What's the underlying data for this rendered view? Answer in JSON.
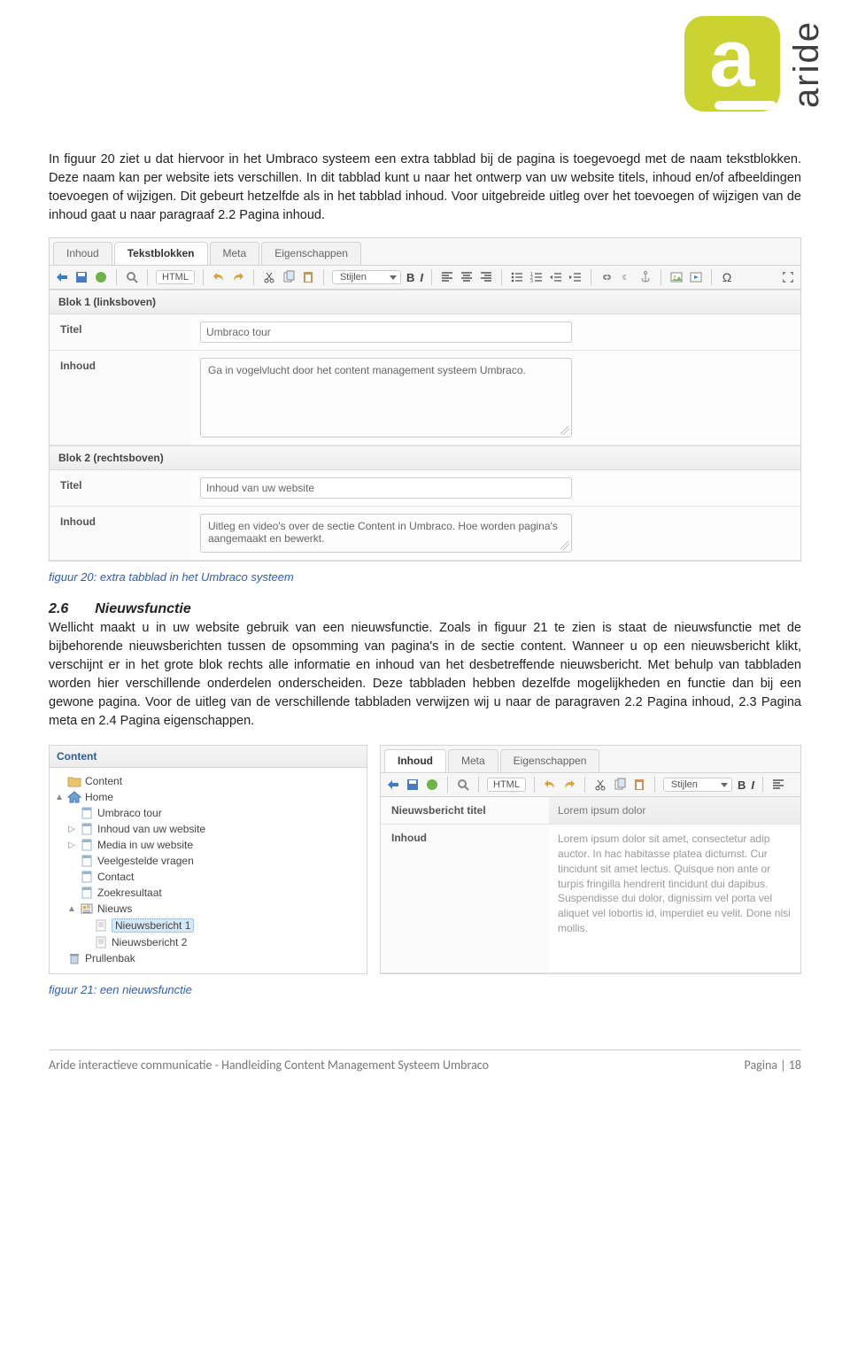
{
  "logo_text": "aride",
  "para1": "In figuur 20 ziet u dat hiervoor in het Umbraco systeem een extra tabblad bij de pagina is toegevoegd met de naam tekstblokken. Deze naam kan per website iets verschillen. In dit tabblad kunt u naar het ontwerp van uw website titels, inhoud en/of afbeeldingen toevoegen of wijzigen. Dit gebeurt hetzelfde als in het tabblad inhoud. Voor uitgebreide uitleg over het toevoegen of wijzigen van de inhoud gaat u naar paragraaf 2.2 Pagina inhoud.",
  "fig20": {
    "tabs": [
      "Inhoud",
      "Tekstblokken",
      "Meta",
      "Eigenschappen"
    ],
    "active_tab_index": 1,
    "toolbar": {
      "html_label": "HTML",
      "styles_label": "Stijlen"
    },
    "block1": {
      "header": "Blok 1 (linksboven)",
      "title_label": "Titel",
      "title_value": "Umbraco tour",
      "content_label": "Inhoud",
      "content_value": "Ga in vogelvlucht door het content management systeem Umbraco."
    },
    "block2": {
      "header": "Blok 2 (rechtsboven)",
      "title_label": "Titel",
      "title_value": "Inhoud van uw website",
      "content_label": "Inhoud",
      "content_value": "Uitleg en video's over de sectie Content in Umbraco. Hoe worden pagina's aangemaakt en bewerkt."
    },
    "caption": "figuur 20: extra tabblad in het Umbraco systeem"
  },
  "section": {
    "num": "2.6",
    "title": "Nieuwsfunctie",
    "body": "Wellicht maakt u in uw website gebruik van een nieuwsfunctie. Zoals in figuur 21 te zien is staat de nieuwsfunctie met de bijbehorende nieuwsberichten tussen de opsomming van pagina's in de sectie content. Wanneer u op een nieuwsbericht klikt, verschijnt er in het grote blok rechts alle informatie en inhoud van het desbetreffende nieuwsbericht. Met behulp van tabbladen worden hier verschillende onderdelen onderscheiden. Deze tabbladen hebben dezelfde mogelijkheden en functie dan bij een gewone pagina. Voor de uitleg van de verschillende tabbladen verwijzen wij u naar de paragraven 2.2 Pagina inhoud, 2.3 Pagina meta en 2.4 Pagina eigenschappen."
  },
  "fig21": {
    "tree_head": "Content",
    "tree": [
      {
        "level": 0,
        "toggle": "",
        "icon": "folder",
        "label": "Content"
      },
      {
        "level": 0,
        "toggle": "▲",
        "icon": "home",
        "label": "Home"
      },
      {
        "level": 1,
        "toggle": "",
        "icon": "page",
        "label": "Umbraco tour"
      },
      {
        "level": 1,
        "toggle": "▷",
        "icon": "page",
        "label": "Inhoud van uw website"
      },
      {
        "level": 1,
        "toggle": "▷",
        "icon": "page",
        "label": "Media in uw website"
      },
      {
        "level": 1,
        "toggle": "",
        "icon": "page",
        "label": "Veelgestelde vragen"
      },
      {
        "level": 1,
        "toggle": "",
        "icon": "page",
        "label": "Contact"
      },
      {
        "level": 1,
        "toggle": "",
        "icon": "page",
        "label": "Zoekresultaat"
      },
      {
        "level": 1,
        "toggle": "▲",
        "icon": "news",
        "label": "Nieuws"
      },
      {
        "level": 2,
        "toggle": "",
        "icon": "doc",
        "label": "Nieuwsbericht 1",
        "selected": true
      },
      {
        "level": 2,
        "toggle": "",
        "icon": "doc",
        "label": "Nieuwsbericht 2"
      },
      {
        "level": 0,
        "toggle": "",
        "icon": "bin",
        "label": "Prullenbak"
      }
    ],
    "right": {
      "tabs": [
        "Inhoud",
        "Meta",
        "Eigenschappen"
      ],
      "active_tab_index": 0,
      "toolbar": {
        "html_label": "HTML",
        "styles_label": "Stijlen"
      },
      "title_label": "Nieuwsbericht titel",
      "title_value": "Lorem ipsum dolor",
      "content_label": "Inhoud",
      "content_value": "Lorem ipsum dolor sit amet, consectetur adip auctor. In hac habitasse platea dictumst. Cur tincidunt sit amet lectus. Quisque non ante or turpis fringilla hendrerit tincidunt dui dapibus. Suspendisse dui dolor, dignissim vel porta vel aliquet vel lobortis id, imperdiet eu velit. Done nisi mollis."
    },
    "caption": "figuur 21: een nieuwsfunctie"
  },
  "footer": {
    "left": "Aride interactieve communicatie  -  Handleiding Content Management Systeem Umbraco",
    "right": "Pagina | 18"
  }
}
